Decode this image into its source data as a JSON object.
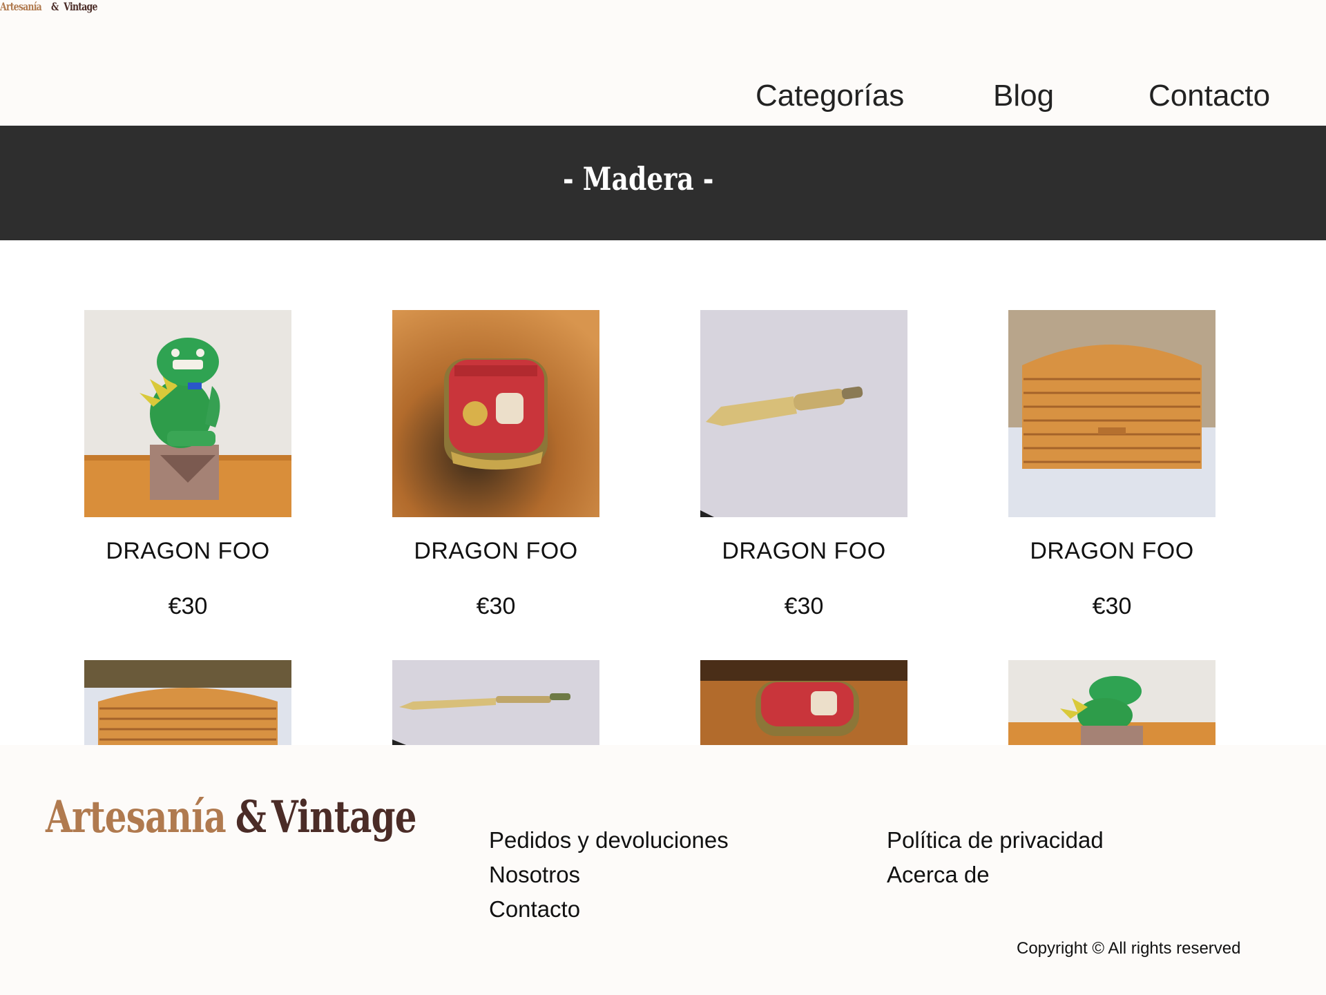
{
  "header": {
    "logo": {
      "part1": "Artesanía",
      "amp": "&",
      "part2": "Vintage"
    },
    "nav": [
      "Categorías",
      "Blog",
      "Contacto"
    ]
  },
  "banner": {
    "title": "- Madera -"
  },
  "products": [
    {
      "name": "DRAGON FOO",
      "price": "€30",
      "image": "foo-dog-figurine"
    },
    {
      "name": "DRAGON FOO",
      "price": "€30",
      "image": "gramophone-tin-box"
    },
    {
      "name": "DRAGON FOO",
      "price": "€30",
      "image": "letter-opener"
    },
    {
      "name": "DRAGON FOO",
      "price": "€30",
      "image": "wooden-bread-box"
    }
  ],
  "products_row2": [
    {
      "image": "wooden-bread-box"
    },
    {
      "image": "letter-opener"
    },
    {
      "image": "gramophone-tin-box"
    },
    {
      "image": "foo-dog-figurine"
    }
  ],
  "footer": {
    "logo": {
      "part1": "Artesanía",
      "amp": "&",
      "part2": "Vintage"
    },
    "links_col1": [
      "Pedidos y devoluciones",
      "Nosotros",
      "Contacto"
    ],
    "links_col2": [
      "Política de privacidad",
      "Acerca de"
    ],
    "copyright": "Copyright © All rights reserved"
  },
  "colors": {
    "logo_tan": "#b07a4f",
    "logo_brown": "#4b2c27",
    "banner": "#2e2e2e",
    "header_bg": "#fdfbf9"
  }
}
